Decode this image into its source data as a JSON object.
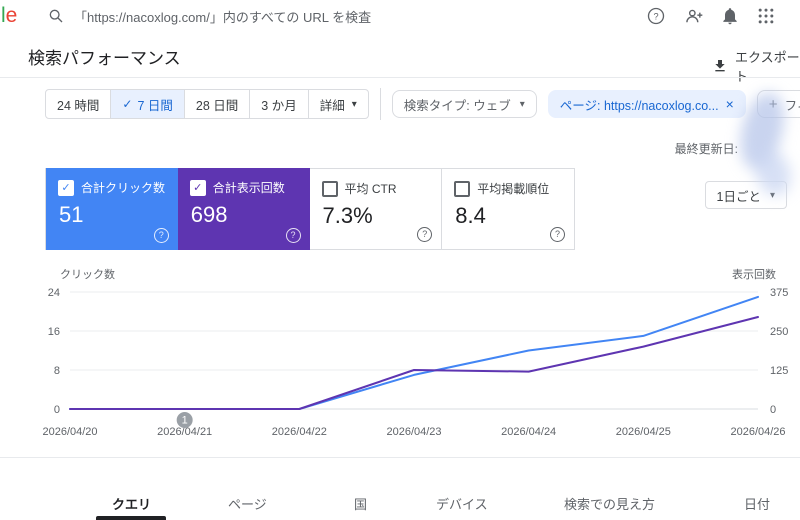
{
  "icons": {
    "check": "✓",
    "close": "×",
    "caret": "▾",
    "plus": "+"
  },
  "topbar": {
    "logo_partial_1": "l",
    "logo_partial_2": "e",
    "search_text": "「https://nacoxlog.com/」内のすべての URL を検査"
  },
  "header": {
    "title": "検索パフォーマンス",
    "export_label": "エクスポート"
  },
  "filters": {
    "date_ranges": [
      {
        "label": "24 時間",
        "selected": false
      },
      {
        "label": "7 日間",
        "selected": true
      },
      {
        "label": "28 日間",
        "selected": false
      },
      {
        "label": "3 か月",
        "selected": false
      },
      {
        "label": "詳細",
        "selected": false
      }
    ],
    "chips": [
      {
        "label": "検索タイプ: ウェブ",
        "type": "dropdown"
      },
      {
        "label": "ページ: https://nacoxlog.co...",
        "type": "removable"
      },
      {
        "label": "フィルタを追加",
        "type": "add"
      }
    ],
    "last_updated": "最終更新日:"
  },
  "metrics": {
    "cards": [
      {
        "label": "合計クリック数",
        "value": "51",
        "checked": true,
        "color": "#4285f4"
      },
      {
        "label": "合計表示回数",
        "value": "698",
        "checked": true,
        "color": "#5e35b1"
      },
      {
        "label": "平均 CTR",
        "value": "7.3%",
        "checked": false
      },
      {
        "label": "平均掲載順位",
        "value": "8.4",
        "checked": false
      }
    ],
    "granularity": "1日ごと"
  },
  "chart_data": {
    "type": "line",
    "x": [
      "2026/04/20",
      "2026/04/21",
      "2026/04/22",
      "2026/04/23",
      "2026/04/24",
      "2026/04/25",
      "2026/04/26"
    ],
    "series": [
      {
        "name": "クリック数",
        "color": "#4285f4",
        "axis": "left",
        "values": [
          0,
          0,
          0,
          7,
          12,
          15,
          23
        ]
      },
      {
        "name": "表示回数",
        "color": "#5e35b1",
        "axis": "right",
        "values": [
          0,
          0,
          0,
          125,
          120,
          200,
          295
        ]
      }
    ],
    "left_axis": {
      "label": "クリック数",
      "ticks": [
        0,
        8,
        16,
        24
      ],
      "max": 24
    },
    "right_axis": {
      "label": "表示回数",
      "ticks": [
        0,
        125,
        250,
        375
      ],
      "max": 375
    },
    "annotation": {
      "label": "1",
      "x_index": 1
    },
    "grid": true,
    "legend_position": "none"
  },
  "tabs": [
    {
      "label": "クエリ",
      "active": true
    },
    {
      "label": "ページ",
      "active": false
    },
    {
      "label": "国",
      "active": false
    },
    {
      "label": "デバイス",
      "active": false
    },
    {
      "label": "検索での見え方",
      "active": false
    },
    {
      "label": "日付",
      "active": false
    }
  ]
}
